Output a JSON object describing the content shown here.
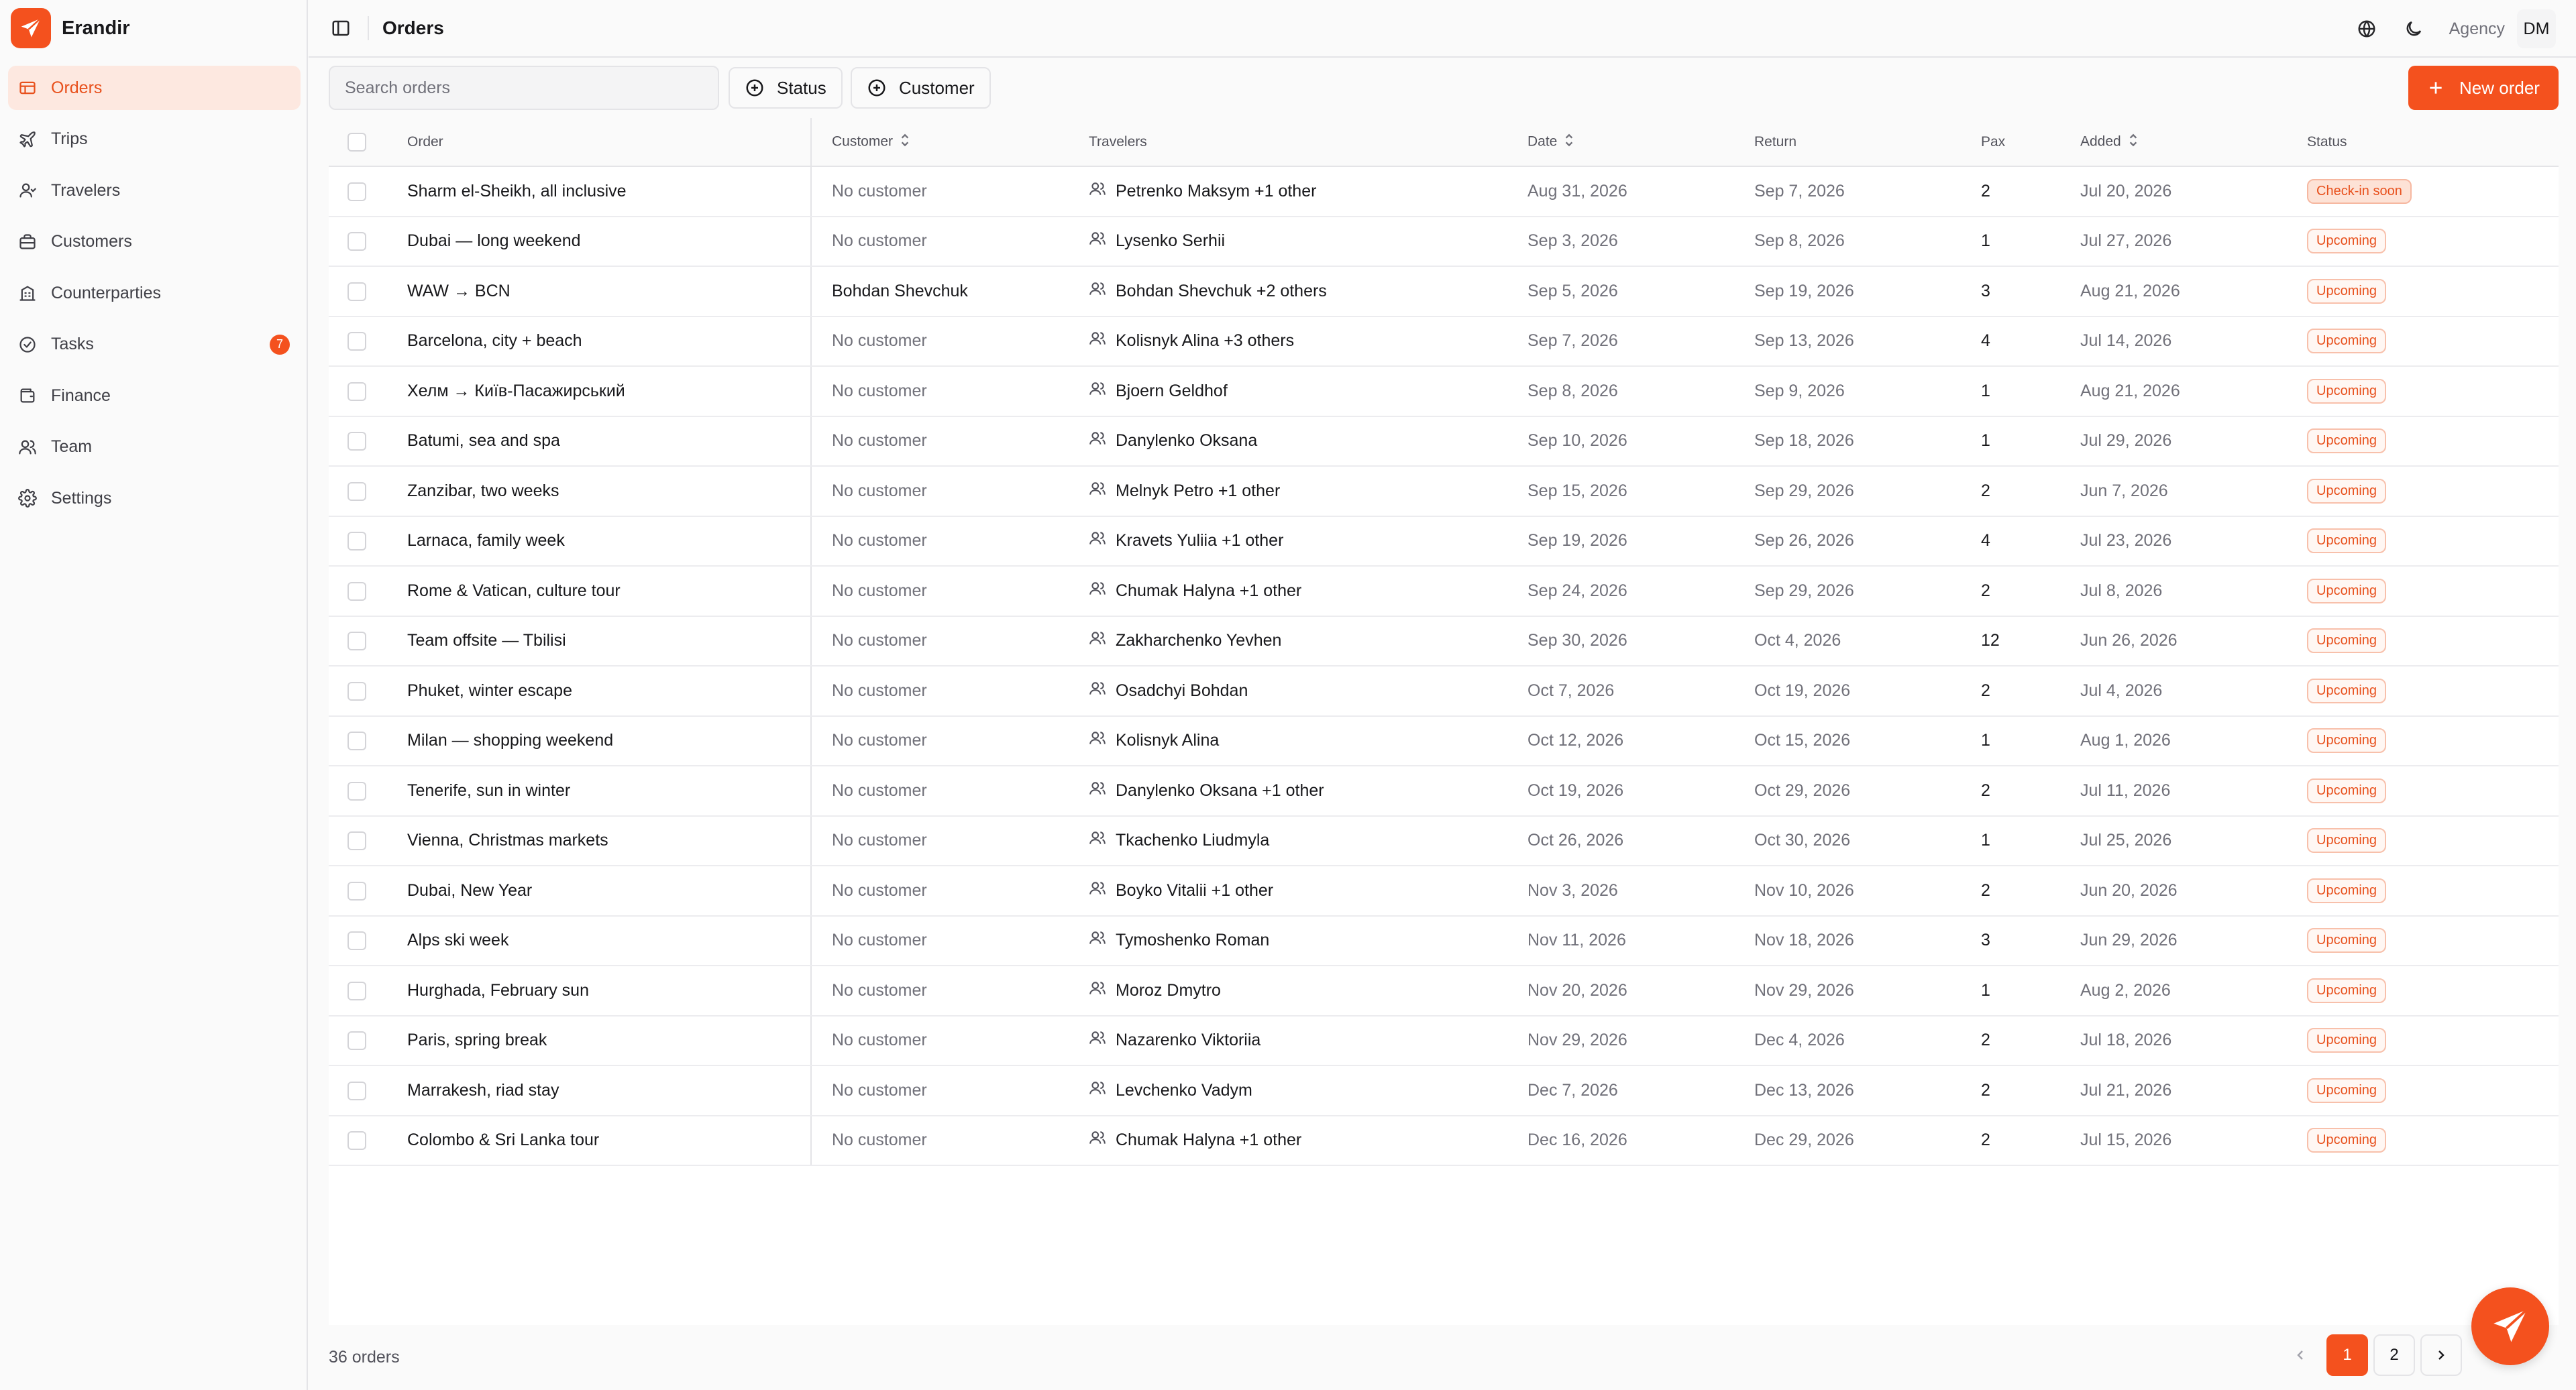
{
  "app": {
    "name": "Erandir",
    "brand_color": "#f4511e"
  },
  "sidebar": {
    "items": [
      {
        "label": "Orders",
        "icon": "orders-icon",
        "active": true
      },
      {
        "label": "Trips",
        "icon": "plane-icon"
      },
      {
        "label": "Travelers",
        "icon": "user-icon"
      },
      {
        "label": "Customers",
        "icon": "briefcase-icon"
      },
      {
        "label": "Counterparties",
        "icon": "building-icon"
      },
      {
        "label": "Tasks",
        "icon": "check-circle-icon",
        "badge": "7"
      },
      {
        "label": "Finance",
        "icon": "wallet-icon"
      },
      {
        "label": "Team",
        "icon": "team-icon"
      },
      {
        "label": "Settings",
        "icon": "gear-icon"
      }
    ]
  },
  "header": {
    "title": "Orders",
    "agency_label": "Agency",
    "avatar_initials": "DM"
  },
  "toolbar": {
    "search_placeholder": "Search orders",
    "status_filter": "Status",
    "customer_filter": "Customer",
    "new_order": "New order"
  },
  "table": {
    "columns": {
      "order": "Order",
      "customer": "Customer",
      "travelers": "Travelers",
      "date": "Date",
      "return": "Return",
      "pax": "Pax",
      "added": "Added",
      "status": "Status"
    },
    "rows": [
      {
        "order": "Sharm el-Sheikh, all inclusive",
        "customer": "No customer",
        "travelers": "Petrenko Maksym +1 other",
        "date": "Aug 31, 2026",
        "return": "Sep 7, 2026",
        "pax": "2",
        "added": "Jul 20, 2026",
        "status": "Check-in soon"
      },
      {
        "order": "Dubai — long weekend",
        "customer": "No customer",
        "travelers": "Lysenko Serhii",
        "date": "Sep 3, 2026",
        "return": "Sep 8, 2026",
        "pax": "1",
        "added": "Jul 27, 2026",
        "status": "Upcoming"
      },
      {
        "order": "WAW → BCN",
        "customer": "Bohdan Shevchuk",
        "travelers": "Bohdan Shevchuk +2 others",
        "date": "Sep 5, 2026",
        "return": "Sep 19, 2026",
        "pax": "3",
        "added": "Aug 21, 2026",
        "status": "Upcoming"
      },
      {
        "order": "Barcelona, city + beach",
        "customer": "No customer",
        "travelers": "Kolisnyk Alina +3 others",
        "date": "Sep 7, 2026",
        "return": "Sep 13, 2026",
        "pax": "4",
        "added": "Jul 14, 2026",
        "status": "Upcoming"
      },
      {
        "order": "Хелм → Київ-Пасажирський",
        "customer": "No customer",
        "travelers": "Bjoern Geldhof",
        "date": "Sep 8, 2026",
        "return": "Sep 9, 2026",
        "pax": "1",
        "added": "Aug 21, 2026",
        "status": "Upcoming"
      },
      {
        "order": "Batumi, sea and spa",
        "customer": "No customer",
        "travelers": "Danylenko Oksana",
        "date": "Sep 10, 2026",
        "return": "Sep 18, 2026",
        "pax": "1",
        "added": "Jul 29, 2026",
        "status": "Upcoming"
      },
      {
        "order": "Zanzibar, two weeks",
        "customer": "No customer",
        "travelers": "Melnyk Petro +1 other",
        "date": "Sep 15, 2026",
        "return": "Sep 29, 2026",
        "pax": "2",
        "added": "Jun 7, 2026",
        "status": "Upcoming"
      },
      {
        "order": "Larnaca, family week",
        "customer": "No customer",
        "travelers": "Kravets Yuliia +1 other",
        "date": "Sep 19, 2026",
        "return": "Sep 26, 2026",
        "pax": "4",
        "added": "Jul 23, 2026",
        "status": "Upcoming"
      },
      {
        "order": "Rome & Vatican, culture tour",
        "customer": "No customer",
        "travelers": "Chumak Halyna +1 other",
        "date": "Sep 24, 2026",
        "return": "Sep 29, 2026",
        "pax": "2",
        "added": "Jul 8, 2026",
        "status": "Upcoming"
      },
      {
        "order": "Team offsite — Tbilisi",
        "customer": "No customer",
        "travelers": "Zakharchenko Yevhen",
        "date": "Sep 30, 2026",
        "return": "Oct 4, 2026",
        "pax": "12",
        "added": "Jun 26, 2026",
        "status": "Upcoming"
      },
      {
        "order": "Phuket, winter escape",
        "customer": "No customer",
        "travelers": "Osadchyi Bohdan",
        "date": "Oct 7, 2026",
        "return": "Oct 19, 2026",
        "pax": "2",
        "added": "Jul 4, 2026",
        "status": "Upcoming"
      },
      {
        "order": "Milan — shopping weekend",
        "customer": "No customer",
        "travelers": "Kolisnyk Alina",
        "date": "Oct 12, 2026",
        "return": "Oct 15, 2026",
        "pax": "1",
        "added": "Aug 1, 2026",
        "status": "Upcoming"
      },
      {
        "order": "Tenerife, sun in winter",
        "customer": "No customer",
        "travelers": "Danylenko Oksana +1 other",
        "date": "Oct 19, 2026",
        "return": "Oct 29, 2026",
        "pax": "2",
        "added": "Jul 11, 2026",
        "status": "Upcoming"
      },
      {
        "order": "Vienna, Christmas markets",
        "customer": "No customer",
        "travelers": "Tkachenko Liudmyla",
        "date": "Oct 26, 2026",
        "return": "Oct 30, 2026",
        "pax": "1",
        "added": "Jul 25, 2026",
        "status": "Upcoming"
      },
      {
        "order": "Dubai, New Year",
        "customer": "No customer",
        "travelers": "Boyko Vitalii +1 other",
        "date": "Nov 3, 2026",
        "return": "Nov 10, 2026",
        "pax": "2",
        "added": "Jun 20, 2026",
        "status": "Upcoming"
      },
      {
        "order": "Alps ski week",
        "customer": "No customer",
        "travelers": "Tymoshenko Roman",
        "date": "Nov 11, 2026",
        "return": "Nov 18, 2026",
        "pax": "3",
        "added": "Jun 29, 2026",
        "status": "Upcoming"
      },
      {
        "order": "Hurghada, February sun",
        "customer": "No customer",
        "travelers": "Moroz Dmytro",
        "date": "Nov 20, 2026",
        "return": "Nov 29, 2026",
        "pax": "1",
        "added": "Aug 2, 2026",
        "status": "Upcoming"
      },
      {
        "order": "Paris, spring break",
        "customer": "No customer",
        "travelers": "Nazarenko Viktoriia",
        "date": "Nov 29, 2026",
        "return": "Dec 4, 2026",
        "pax": "2",
        "added": "Jul 18, 2026",
        "status": "Upcoming"
      },
      {
        "order": "Marrakesh, riad stay",
        "customer": "No customer",
        "travelers": "Levchenko Vadym",
        "date": "Dec 7, 2026",
        "return": "Dec 13, 2026",
        "pax": "2",
        "added": "Jul 21, 2026",
        "status": "Upcoming"
      },
      {
        "order": "Colombo & Sri Lanka tour",
        "customer": "No customer",
        "travelers": "Chumak Halyna +1 other",
        "date": "Dec 16, 2026",
        "return": "Dec 29, 2026",
        "pax": "2",
        "added": "Jul 15, 2026",
        "status": "Upcoming"
      }
    ]
  },
  "footer": {
    "count": "36 orders",
    "pages": [
      "1",
      "2"
    ],
    "current_page": "1"
  }
}
